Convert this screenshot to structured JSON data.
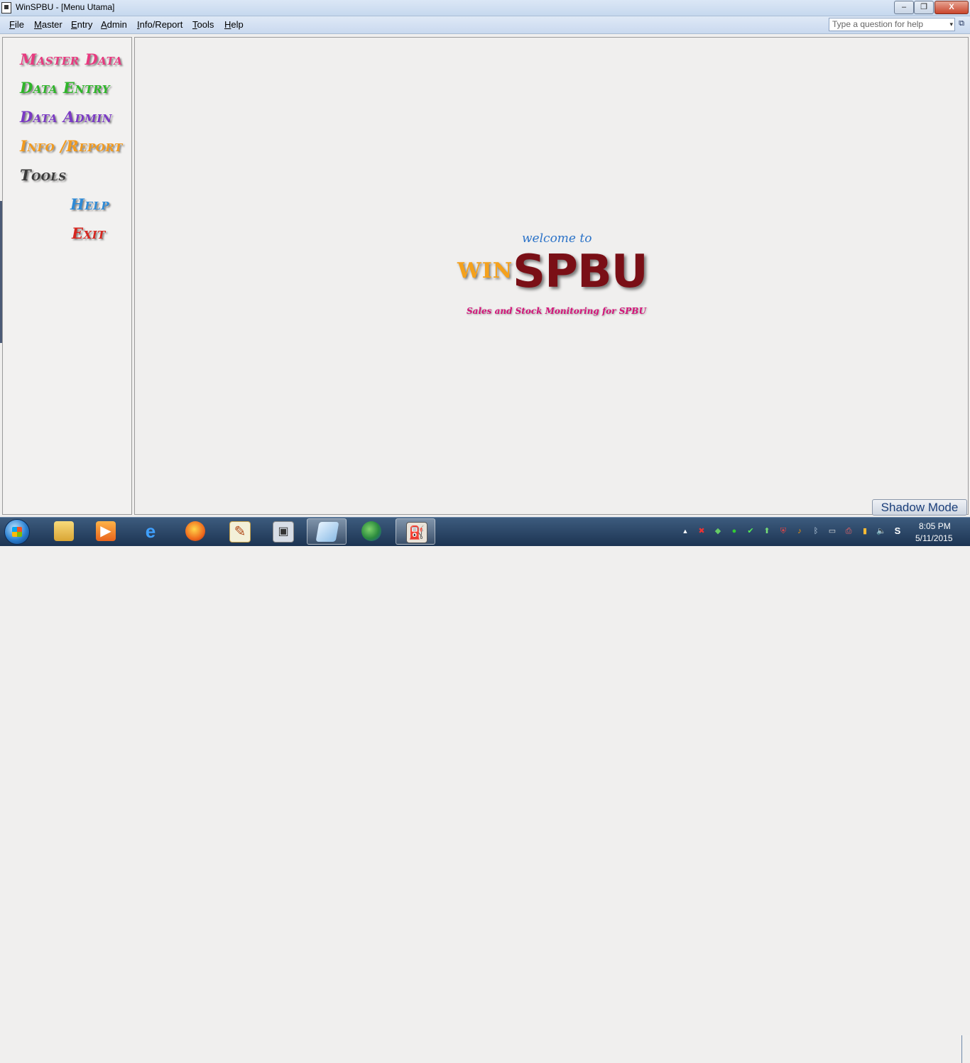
{
  "window": {
    "title": "WinSPBU - [Menu Utama]",
    "minimize": "–",
    "restore": "❐",
    "close": "X"
  },
  "menubar": {
    "items": [
      {
        "prefix": "",
        "accel": "F",
        "rest": "ile"
      },
      {
        "prefix": "",
        "accel": "M",
        "rest": "aster"
      },
      {
        "prefix": "",
        "accel": "E",
        "rest": "ntry"
      },
      {
        "prefix": "",
        "accel": "A",
        "rest": "dmin"
      },
      {
        "prefix": "",
        "accel": "I",
        "rest": "nfo/Report"
      },
      {
        "prefix": "",
        "accel": "T",
        "rest": "ools"
      },
      {
        "prefix": "",
        "accel": "H",
        "rest": "elp"
      }
    ],
    "help_placeholder": "Type a question for help",
    "help_dropdown": "▾",
    "mdi_restore": "⧉"
  },
  "sidebar": {
    "items": [
      {
        "label": "Master Data",
        "color": "#e8397f"
      },
      {
        "label": "Data Entry",
        "color": "#2fb52a"
      },
      {
        "label": "Data Admin",
        "color": "#7b3ac4"
      },
      {
        "label": "Info /Report",
        "color": "#f19a1f"
      },
      {
        "label": "Tools",
        "color": "#3a3a3a"
      },
      {
        "label": "Help",
        "color": "#2e8ad6"
      },
      {
        "label": "Exit",
        "color": "#d6261f"
      }
    ]
  },
  "main": {
    "welcome": "welcome to",
    "logo_win": "WIN",
    "logo_spbu": "SPBU",
    "tagline": "Sales and Stock Monitoring for SPBU",
    "colors": {
      "win": "#f5a11c",
      "spbu": "#7a0f16",
      "tagline": "#d4147a",
      "welcome": "#2c73c8"
    }
  },
  "shadow_mode": "Shadow Mode",
  "taskbar": {
    "apps": [
      {
        "icon": "folder-icon"
      },
      {
        "icon": "media-player-icon"
      },
      {
        "icon": "internet-explorer-icon"
      },
      {
        "icon": "firefox-icon"
      },
      {
        "icon": "notepad-icon"
      },
      {
        "icon": "virtual-machine-icon"
      },
      {
        "icon": "screen-icon",
        "active": true
      },
      {
        "icon": "globe-icon"
      },
      {
        "icon": "fuel-pump-icon",
        "active": true
      }
    ],
    "tray": [
      "show-hidden-icon",
      "flag-icon",
      "network-app-icon",
      "green-circle-icon",
      "checkmark-icon",
      "update-icon",
      "shield-icon",
      "audio-app-icon",
      "bluetooth-icon",
      "monitor-icon",
      "printer-icon",
      "network-icon",
      "volume-icon",
      "skype-icon"
    ],
    "time": "8:05 PM",
    "date": "5/11/2015"
  }
}
